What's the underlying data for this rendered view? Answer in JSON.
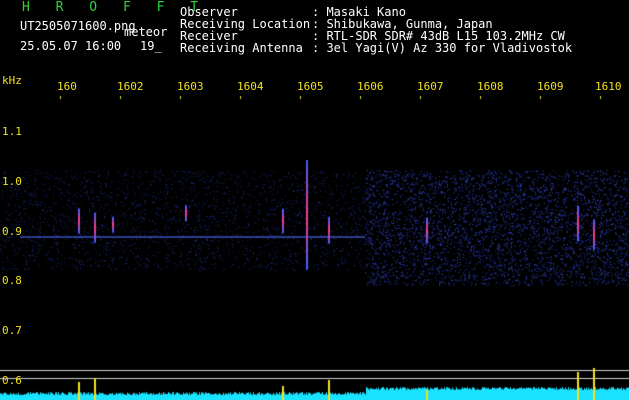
{
  "header": {
    "station": "H R O F F T",
    "filename": "UT2505071600.png",
    "meteor_label": "meteor",
    "date_time": "25.05.07 16:00",
    "count": "19_",
    "fields": [
      {
        "label": "Observer",
        "value": ": Masaki Kano"
      },
      {
        "label": "Receiving Location",
        "value": ": Shibukawa, Gunma, Japan"
      },
      {
        "label": "Receiver",
        "value": ": RTL-SDR SDR# 43dB L15 103.2MHz CW"
      },
      {
        "label": "Receiving Antenna",
        "value": ": 3el Yagi(V) Az 330 for Vladivostok"
      }
    ]
  },
  "axes": {
    "y_unit": "kHz",
    "y_ticks": [
      "1.1",
      "1.0",
      "0.9",
      "0.8",
      "0.7",
      "0.6"
    ],
    "x_ticks": [
      "160",
      "1602",
      "1603",
      "1604",
      "1605",
      "1606",
      "1607",
      "1608",
      "1609",
      "1610"
    ]
  },
  "colors": {
    "background": "#000000",
    "axis_text": "#f2e21a",
    "station_text": "#33d13a",
    "noise": "#1a2ccc",
    "power_trace": "#19e3ff"
  }
}
